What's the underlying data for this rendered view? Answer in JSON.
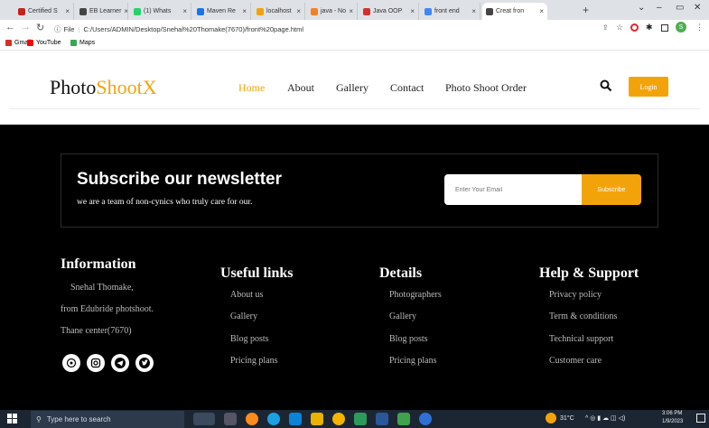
{
  "browser": {
    "tabs": [
      {
        "label": "Certified S",
        "color": "#c5221f"
      },
      {
        "label": "EB Learner",
        "color": "#444444"
      },
      {
        "label": "(1) Whats",
        "color": "#25d366"
      },
      {
        "label": "Maven Re",
        "color": "#1a73e8"
      },
      {
        "label": "localhost",
        "color": "#f0a30a"
      },
      {
        "label": "java - No",
        "color": "#f48024"
      },
      {
        "label": "Java OOP",
        "color": "#d32f2f"
      },
      {
        "label": "front end",
        "color": "#4285f4"
      },
      {
        "label": "Creat fron",
        "color": "#444444"
      }
    ],
    "new_tab": "+",
    "url_scheme": "File",
    "url": "C:/Users/ADMIN/Desktop/Snehal%20Thomake(7670)/front%20page.html",
    "bookmarks": [
      {
        "label": "Gmail",
        "color": "#d93025"
      },
      {
        "label": "YouTube",
        "color": "#ff0000"
      },
      {
        "label": "Maps",
        "color": "#34a853"
      }
    ],
    "profile_initial": "S"
  },
  "site": {
    "logo_main": "Photo",
    "logo_accent": "ShootX",
    "nav": [
      "Home",
      "About",
      "Gallery",
      "Contact",
      "Photo Shoot Order"
    ],
    "login_label": "Login",
    "accent_color": "#f3a30a"
  },
  "newsletter": {
    "title": "Subscribe our newsletter",
    "description": "we are a team of non-cynics who truly care for our.",
    "email_placeholder": "Enter Your Email",
    "button": "Subscribe"
  },
  "footer": {
    "information": {
      "heading": "Information",
      "lines": [
        "Snehal Thomake,",
        "from Edubride photshoot.",
        "Thane center(7670)"
      ]
    },
    "social_icons": [
      "whatsapp-icon",
      "instagram-icon",
      "telegram-icon",
      "twitter-icon"
    ],
    "useful_links": {
      "heading": "Useful links",
      "items": [
        "About us",
        "Gallery",
        "Blog posts",
        "Pricing plans"
      ]
    },
    "details": {
      "heading": "Details",
      "items": [
        "Photographers",
        "Gallery",
        "Blog posts",
        "Pricing plans"
      ]
    },
    "help": {
      "heading": "Help & Support",
      "items": [
        "Privacy policy",
        "Term & conditions",
        "Technical support",
        "Customer care"
      ]
    }
  },
  "taskbar": {
    "search_placeholder": "Type here to search",
    "weather": "31°C",
    "time": "3:06 PM",
    "date": "1/9/2023"
  }
}
